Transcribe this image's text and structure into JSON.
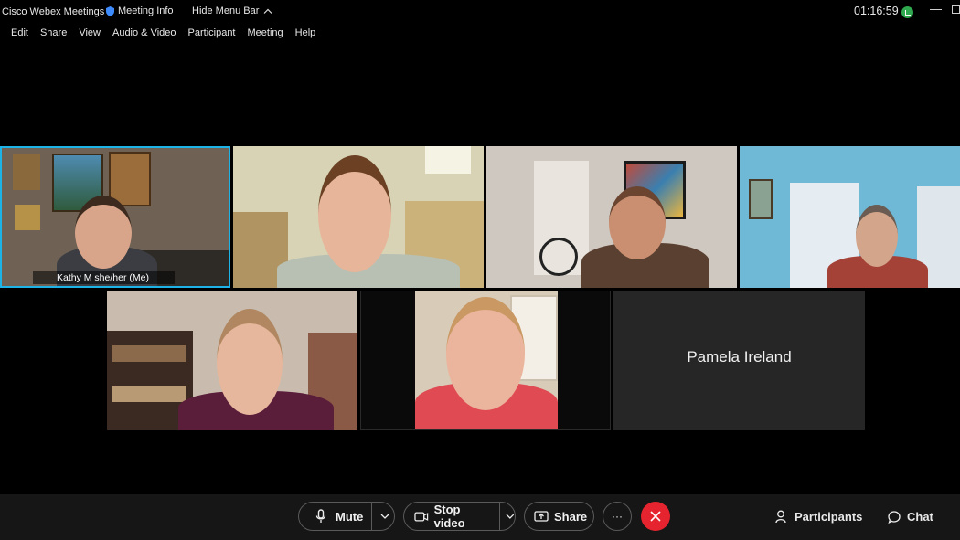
{
  "titlebar": {
    "app_name": "Cisco Webex Meetings",
    "meeting_info": "Meeting Info",
    "hide_menu": "Hide Menu Bar",
    "clock": "01:16:59"
  },
  "menu": {
    "items": [
      "Edit",
      "Share",
      "View",
      "Audio & Video",
      "Participant",
      "Meeting",
      "Help"
    ]
  },
  "tiles": {
    "self_name": "Kathy M she/her  (Me)",
    "avatar_name": "Pamela Ireland"
  },
  "controls": {
    "mute": "Mute",
    "stop_video": "Stop video",
    "share": "Share",
    "more": "···",
    "participants": "Participants",
    "chat": "Chat"
  },
  "colors": {
    "active_border": "#1eb3e6",
    "end_call": "#e5242f",
    "network_ok": "#2fa84f"
  }
}
